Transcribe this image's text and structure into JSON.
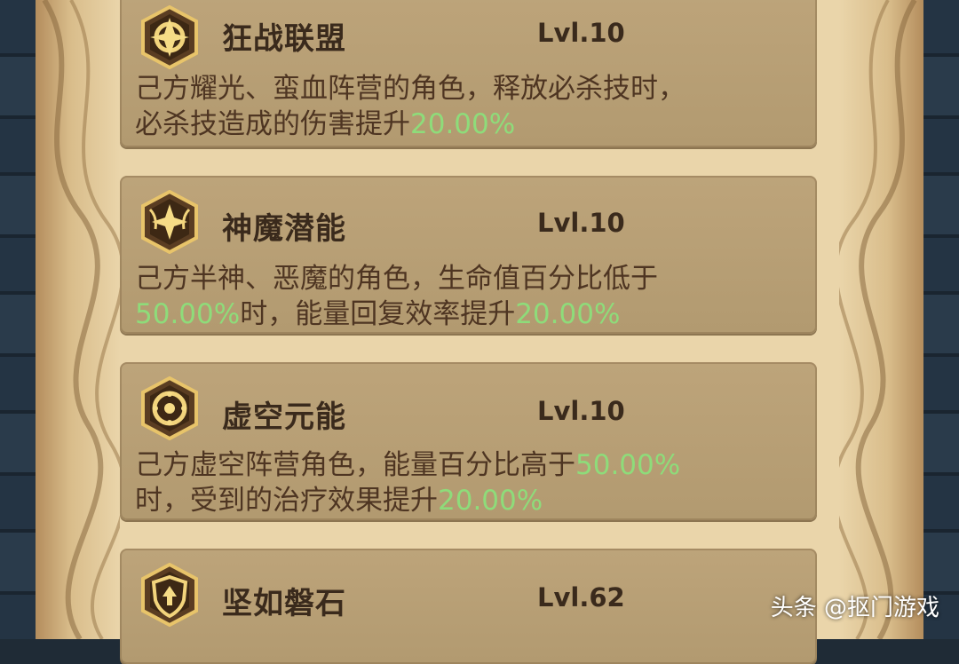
{
  "cards": [
    {
      "title": "狂战联盟",
      "level": "Lvl.10",
      "icon": "rage-crest-icon",
      "desc": [
        {
          "t": "己方耀光、蛮血阵营的角色，释放必杀技时，",
          "h": false
        },
        {
          "t": "必杀技造成的伤害提升",
          "h": false
        },
        {
          "t": "20.00%",
          "h": true
        }
      ]
    },
    {
      "title": "神魔潜能",
      "level": "Lvl.10",
      "icon": "wing-star-icon",
      "desc": [
        {
          "t": "己方半神、恶魔的角色，生命值百分比低于",
          "h": false
        },
        {
          "t": "50.00%",
          "h": true
        },
        {
          "t": "时，能量回复效率提升",
          "h": false
        },
        {
          "t": "20.00%",
          "h": true
        }
      ]
    },
    {
      "title": "虚空元能",
      "level": "Lvl.10",
      "icon": "void-orb-icon",
      "desc": [
        {
          "t": "己方虚空阵营角色，能量百分比高于",
          "h": false
        },
        {
          "t": "50.00%",
          "h": true
        },
        {
          "t": "时，受到的治疗效果提升",
          "h": false
        },
        {
          "t": "20.00%",
          "h": true
        }
      ]
    },
    {
      "title": "坚如磐石",
      "level": "Lvl.62",
      "icon": "shield-arrow-icon",
      "desc": []
    }
  ],
  "watermark": "头条 @抠门游戏",
  "colors": {
    "highlight": "#8edc7a",
    "text": "#4e3522",
    "title": "#3a2a1c",
    "card": "#b8a075",
    "parchment": "#ead5aa"
  }
}
